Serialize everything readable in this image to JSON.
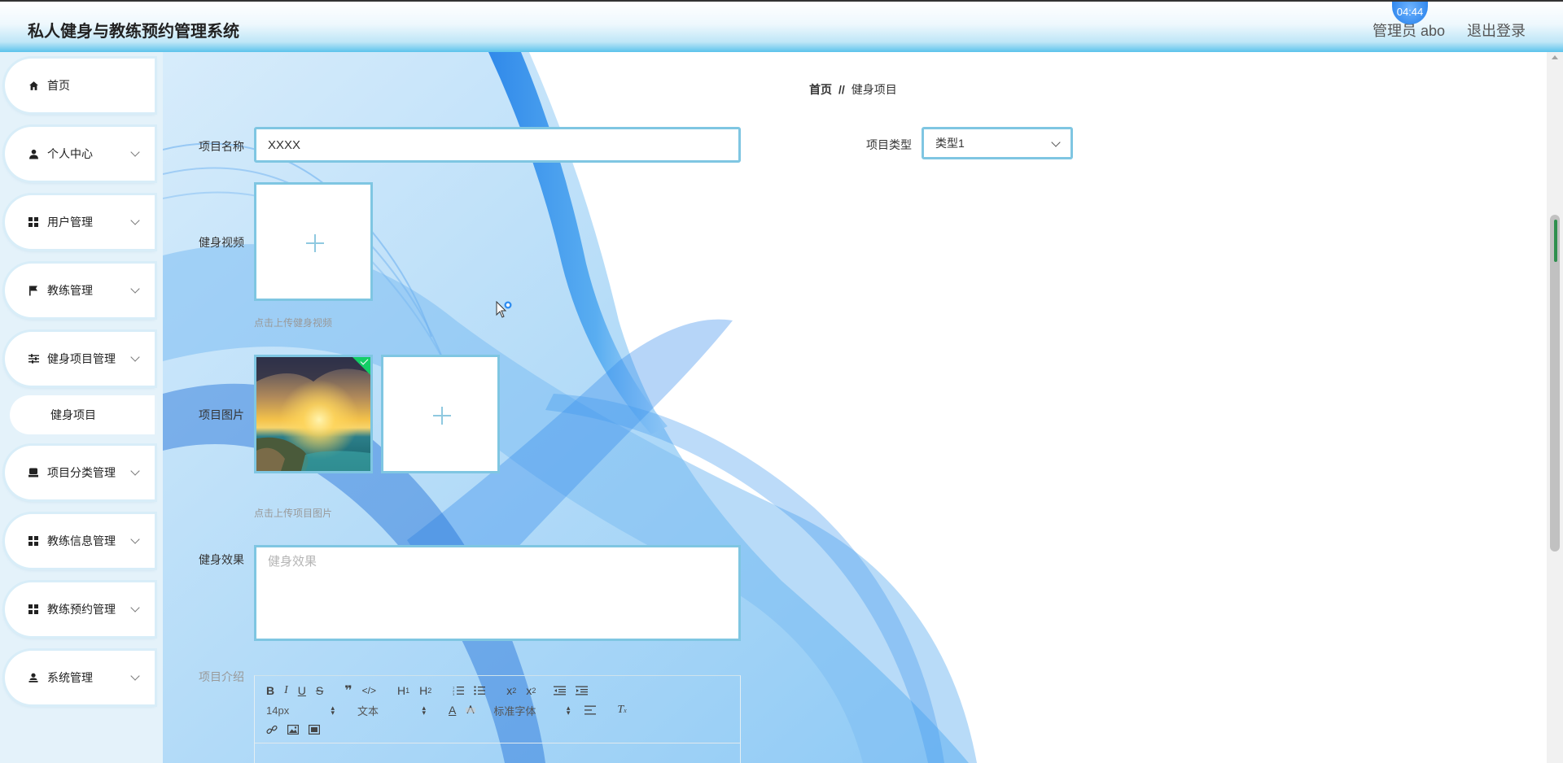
{
  "header": {
    "app_title": "私人健身与教练预约管理系统",
    "user_label": "管理员 abo",
    "logout_label": "退出登录",
    "timer": "04:44"
  },
  "sidebar": {
    "items": [
      {
        "label": "首页",
        "icon": "home-icon",
        "expandable": false
      },
      {
        "label": "个人中心",
        "icon": "person-icon",
        "expandable": true
      },
      {
        "label": "用户管理",
        "icon": "grid-icon",
        "expandable": true
      },
      {
        "label": "教练管理",
        "icon": "flag-icon",
        "expandable": true
      },
      {
        "label": "健身项目管理",
        "icon": "sliders-icon",
        "expandable": true
      },
      {
        "label": "项目分类管理",
        "icon": "box-icon",
        "expandable": true
      },
      {
        "label": "教练信息管理",
        "icon": "grid-icon",
        "expandable": true
      },
      {
        "label": "教练预约管理",
        "icon": "grid-icon",
        "expandable": true
      },
      {
        "label": "系统管理",
        "icon": "user-cog-icon",
        "expandable": true
      }
    ],
    "sub_item": "健身项目"
  },
  "breadcrumb": {
    "home": "首页",
    "separator": "//",
    "current": "健身项目"
  },
  "form": {
    "name_label": "项目名称",
    "name_value": "XXXX",
    "type_label": "项目类型",
    "type_value": "类型1",
    "video_label": "健身视频",
    "video_hint": "点击上传健身视频",
    "image_label": "项目图片",
    "image_hint": "点击上传项目图片",
    "effect_label": "健身效果",
    "effect_placeholder": "健身效果",
    "intro_label": "项目介绍"
  },
  "editor": {
    "font_size": "14px",
    "paragraph": "文本",
    "font_family": "标准字体",
    "buttons": [
      "bold",
      "italic",
      "underline",
      "strike",
      "blockquote",
      "code-block",
      "header-1",
      "header-2",
      "ordered-list",
      "bullet-list",
      "subscript",
      "superscript",
      "indent-decrease",
      "indent-increase",
      "font-color",
      "background-color",
      "align",
      "clean",
      "link",
      "image",
      "video"
    ]
  },
  "colors": {
    "accent": "#7fc6e2",
    "header_gradient_end": "#5cc3ec",
    "sidebar_bg": "#e4f2fa",
    "success": "#13ce66",
    "badge": "#1f7be8"
  }
}
